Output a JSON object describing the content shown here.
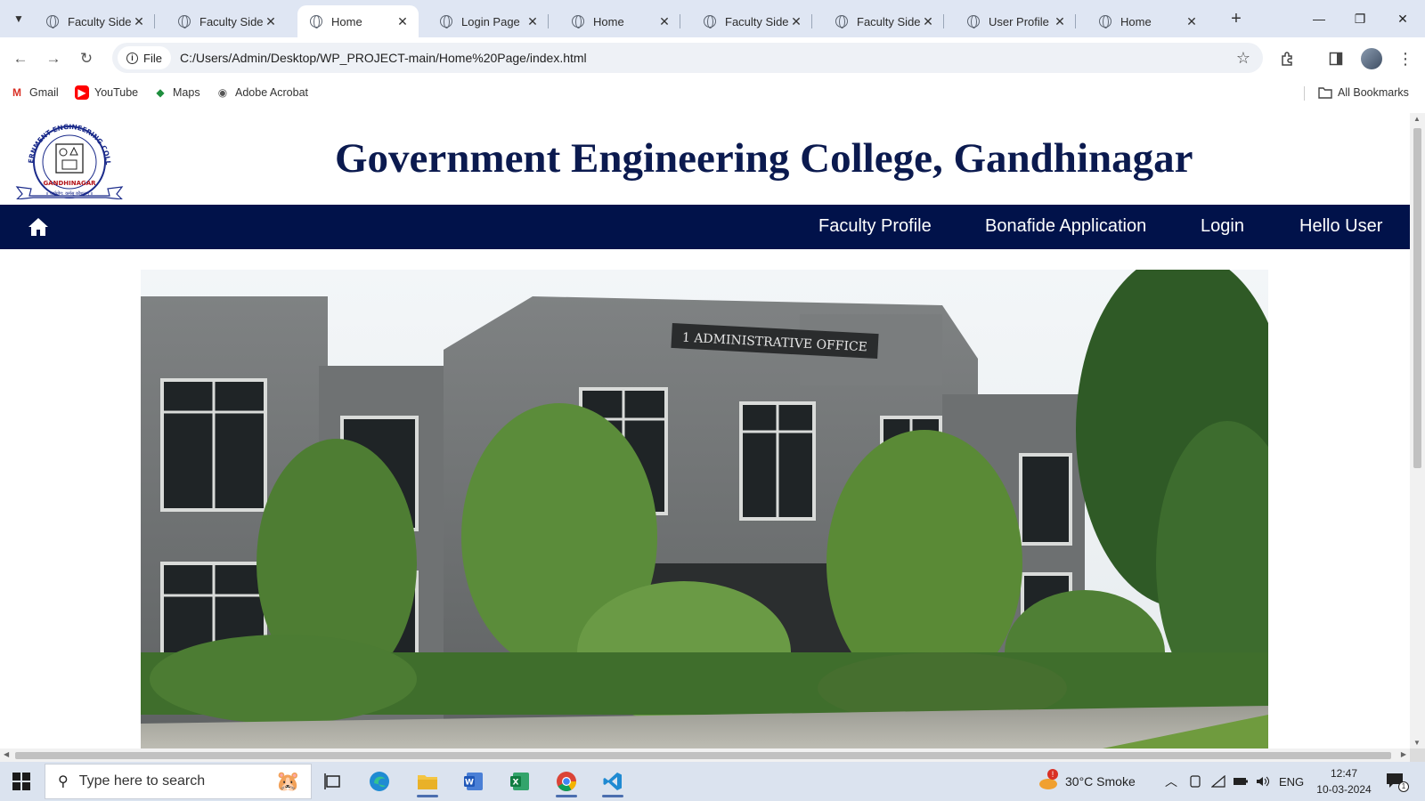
{
  "browser": {
    "tabs": [
      {
        "label": "Faculty Side",
        "active": false
      },
      {
        "label": "Faculty Side",
        "active": false
      },
      {
        "label": "Home",
        "active": true
      },
      {
        "label": "Login Page",
        "active": false
      },
      {
        "label": "Home",
        "active": false
      },
      {
        "label": "Faculty Side",
        "active": false
      },
      {
        "label": "Faculty Side",
        "active": false
      },
      {
        "label": "User Profile",
        "active": false
      },
      {
        "label": "Home",
        "active": false
      }
    ],
    "tab_close_glyph": "✕",
    "new_tab_glyph": "+",
    "window_controls": {
      "minimize": "—",
      "restore": "❐",
      "close": "✕"
    },
    "address_bar": {
      "scheme_chip": "File",
      "url": "C:/Users/Admin/Desktop/WP_PROJECT-main/Home%20Page/index.html"
    },
    "bookmarks": [
      {
        "label": "Gmail",
        "icon": "gmail-icon"
      },
      {
        "label": "YouTube",
        "icon": "youtube-icon"
      },
      {
        "label": "Maps",
        "icon": "maps-icon"
      },
      {
        "label": "Adobe Acrobat",
        "icon": "globe-icon"
      }
    ],
    "all_bookmarks": "All Bookmarks"
  },
  "site": {
    "logo": {
      "top_text": "GOVERNMENT ENGINEERING COLLEGE",
      "bottom_text": "GANDHINAGAR",
      "banner_text": "॥ कर्मयोग: कर्मसु कौशलम् ॥"
    },
    "title": "Government Engineering College, Gandhinagar",
    "nav": {
      "home_icon": "home-icon",
      "links": [
        "Faculty Profile",
        "Bonafide Application",
        "Login",
        "Hello User"
      ]
    },
    "hero": {
      "sign_text": "1 ADMINISTRATIVE OFFICE"
    }
  },
  "taskbar": {
    "search_placeholder": "Type here to search",
    "weather": "30°C  Smoke",
    "weather_badge": "!",
    "language": "ENG",
    "time": "12:47",
    "date": "10-03-2024",
    "notifications": "1"
  },
  "colors": {
    "navbar": "#01124a",
    "title": "#0b1a4f",
    "tabstrip": "#dfe6f3",
    "taskbar": "#dbe3ef"
  }
}
